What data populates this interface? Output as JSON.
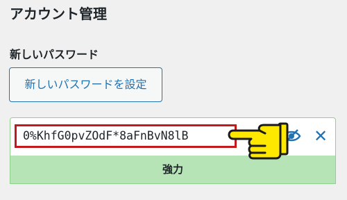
{
  "page": {
    "heading": "アカウント管理",
    "password_section": {
      "label": "新しいパスワード",
      "set_button_label": "新しいパスワードを設定",
      "password_value": "0%KhfG0pvZOdF*8aFnBvN8lB",
      "strength_label": "強力",
      "icons": {
        "visibility": "eye-icon",
        "cancel": "close-icon",
        "pointer": "pointing-hand-icon"
      }
    }
  },
  "colors": {
    "accent": "#2271b1",
    "highlight_border": "#c2191c",
    "strength_strong": "#b7e4b7",
    "pointer_fill": "#ffe800"
  }
}
